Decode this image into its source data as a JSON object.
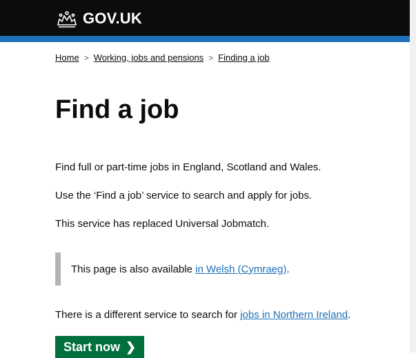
{
  "header": {
    "logo_text": "GOV.UK",
    "logo_icon": "crown-icon"
  },
  "breadcrumb": {
    "items": [
      "Home",
      "Working, jobs and pensions",
      "Finding a job"
    ],
    "separator": ">"
  },
  "main": {
    "title": "Find a job",
    "paragraphs": [
      "Find full or part-time jobs in England, Scotland and Wales.",
      "Use the ‘Find a job’ service to search and apply for jobs.",
      "This service has replaced Universal Jobmatch."
    ],
    "inset": {
      "prefix": "This page is also available ",
      "link": "in Welsh (Cymraeg)",
      "suffix": "."
    },
    "ni": {
      "prefix": "There is a different service to search for ",
      "link": "jobs in Northern Ireland",
      "suffix": "."
    },
    "start_label": "Start now"
  },
  "colors": {
    "header": "#0b0c0c",
    "accent_bar": "#1d70b8",
    "link": "#1d70b8",
    "button": "#00703c"
  }
}
